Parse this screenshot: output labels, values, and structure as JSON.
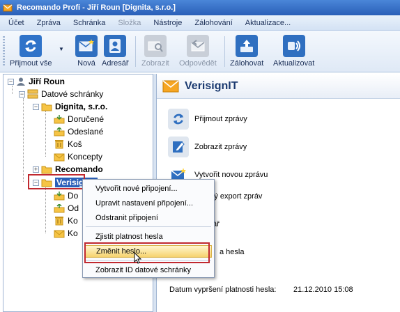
{
  "window": {
    "title": "Recomando Profi - Jiří Roun [Dignita, s.r.o.]"
  },
  "menu": [
    {
      "label": "Účet",
      "disabled": false
    },
    {
      "label": "Zpráva",
      "disabled": false
    },
    {
      "label": "Schránka",
      "disabled": false
    },
    {
      "label": "Složka",
      "disabled": true
    },
    {
      "label": "Nástroje",
      "disabled": false
    },
    {
      "label": "Zálohování",
      "disabled": false
    },
    {
      "label": "Aktualizace...",
      "disabled": false
    }
  ],
  "toolbar": {
    "receive_all": "Přijmout vše",
    "new": "Nová",
    "address_book": "Adresář",
    "show": "Zobrazit",
    "reply": "Odpovědět",
    "backup": "Zálohovat",
    "update": "Aktualizovat"
  },
  "tree": {
    "user": "Jiří Roun",
    "mailboxes": "Datové schránky",
    "dignita": {
      "label": "Dignita, s.r.o.",
      "folders": [
        "Doručené",
        "Odeslané",
        "Koš",
        "Koncepty"
      ]
    },
    "recomando": "Recomando",
    "verisign": {
      "label": "VerisignIT",
      "folders": [
        "Do",
        "Od",
        "Ko",
        "Ko"
      ]
    }
  },
  "panel": {
    "title": "VerisignIT",
    "actions": [
      "Přijmout zprávy",
      "Zobrazit zprávy",
      "Vytvořit novou zprávu",
      "adný export zpráv",
      "ář",
      "a hesla"
    ],
    "expiry_label": "Datum vypršení platnosti hesla:",
    "expiry_value": "21.12.2010 15:08"
  },
  "context_menu": {
    "items": [
      "Vytvořit nové připojení...",
      "Upravit nastavení připojení...",
      "Odstranit připojení",
      "Zjistit platnost hesla",
      "Změnit heslo...",
      "Zobrazit ID datové schránky"
    ]
  },
  "colors": {
    "accent": "#2a5fb8",
    "highlight": "#f6d36e",
    "annotation": "#c0282f"
  }
}
